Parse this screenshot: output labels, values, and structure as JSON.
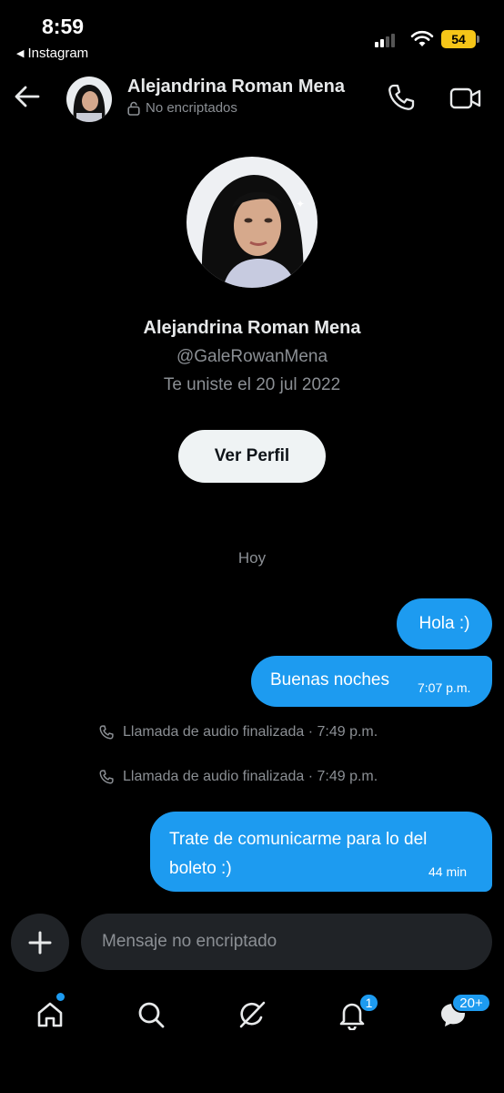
{
  "status_bar": {
    "time": "8:59",
    "back_app": "Instagram",
    "battery": "54",
    "battery_color": "#f5c518"
  },
  "header": {
    "name": "Alejandrina Roman Mena",
    "encryption": "No encriptados",
    "icons": [
      "back-arrow-icon",
      "lock-icon",
      "phone-icon",
      "video-camera-icon"
    ]
  },
  "profile": {
    "name": "Alejandrina Roman Mena",
    "handle": "@GaleRowanMena",
    "joined": "Te uniste el 20 jul 2022",
    "view_profile_label": "Ver Perfil"
  },
  "conversation": {
    "day_separator": "Hoy",
    "messages": [
      {
        "text": "Hola :)",
        "time": ""
      },
      {
        "text": "Buenas noches",
        "time": "7:07 p.m."
      }
    ],
    "calls": [
      {
        "text": "Llamada de audio finalizada · 7:49 p.m."
      },
      {
        "text": "Llamada de audio finalizada · 7:49 p.m."
      }
    ],
    "last_message": {
      "text": "Trate de comunicarme para lo del boleto :)",
      "time": "44 min"
    }
  },
  "composer": {
    "placeholder": "Mensaje no encriptado"
  },
  "bottom_nav": {
    "items": [
      "home-icon",
      "search-icon",
      "grok-icon",
      "notifications-icon",
      "messages-icon"
    ],
    "notifications_badge": "1",
    "messages_badge": "20+"
  },
  "colors": {
    "accent": "#1d9bf0",
    "background": "#000000",
    "secondary_text": "#8b8f94"
  }
}
